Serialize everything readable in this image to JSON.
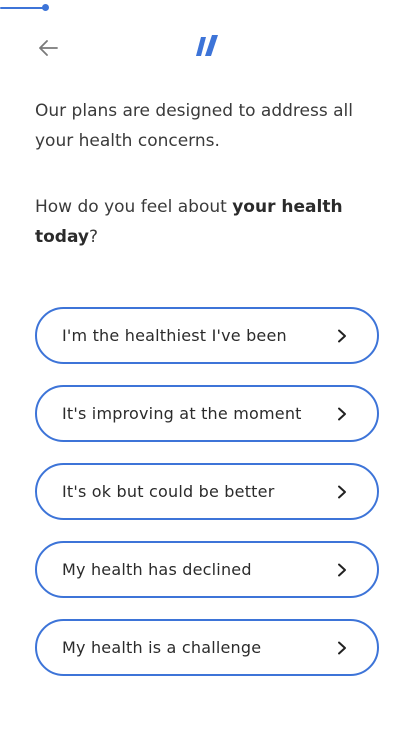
{
  "progress": {
    "fraction": 0.11
  },
  "header": {
    "back_icon": "arrow-left-icon",
    "logo_icon": "double-slash-logo-icon"
  },
  "intro": {
    "text": "Our plans are designed to address all your health concerns."
  },
  "question": {
    "prefix": "How do you feel about ",
    "bold_1": "your health",
    "middle": " ",
    "bold_2": "today",
    "suffix": "?"
  },
  "options": [
    {
      "label": "I'm the healthiest I've been",
      "icon": "chevron-right-icon"
    },
    {
      "label": "It's improving at the moment",
      "icon": "chevron-right-icon"
    },
    {
      "label": "It's ok but could be better",
      "icon": "chevron-right-icon"
    },
    {
      "label": "My health has declined",
      "icon": "chevron-right-icon"
    },
    {
      "label": "My health is a challenge",
      "icon": "chevron-right-icon"
    }
  ],
  "colors": {
    "accent": "#3d74d8",
    "text": "#2b2b2b",
    "background": "#ffffff"
  }
}
